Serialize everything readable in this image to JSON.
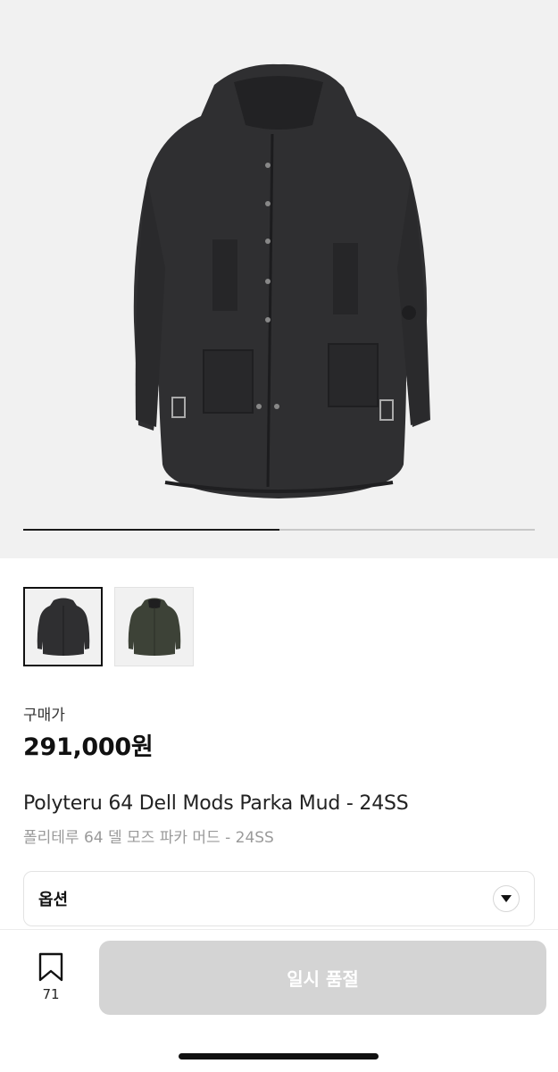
{
  "gallery": {
    "image_alt": "hooded parka product photo",
    "progress": 0.5,
    "thumbnails": [
      {
        "name": "thumbnail-black",
        "selected": true
      },
      {
        "name": "thumbnail-olive",
        "selected": false
      }
    ]
  },
  "price": {
    "label": "구매가",
    "value": "291,000원"
  },
  "product": {
    "title_en": "Polyteru 64 Dell Mods Parka Mud - 24SS",
    "title_ko": "폴리테루 64 델 모즈 파카 머드 - 24SS"
  },
  "option": {
    "label": "옵션",
    "toggle_icon": "chevron-down-icon"
  },
  "bottom": {
    "bookmark_icon": "bookmark-icon",
    "bookmark_count": "71",
    "button_label": "일시 품절"
  },
  "colors": {
    "hero_bg": "#f1f1f1",
    "button_disabled": "#d4d4d4",
    "muted_text": "#9a9a9a"
  }
}
